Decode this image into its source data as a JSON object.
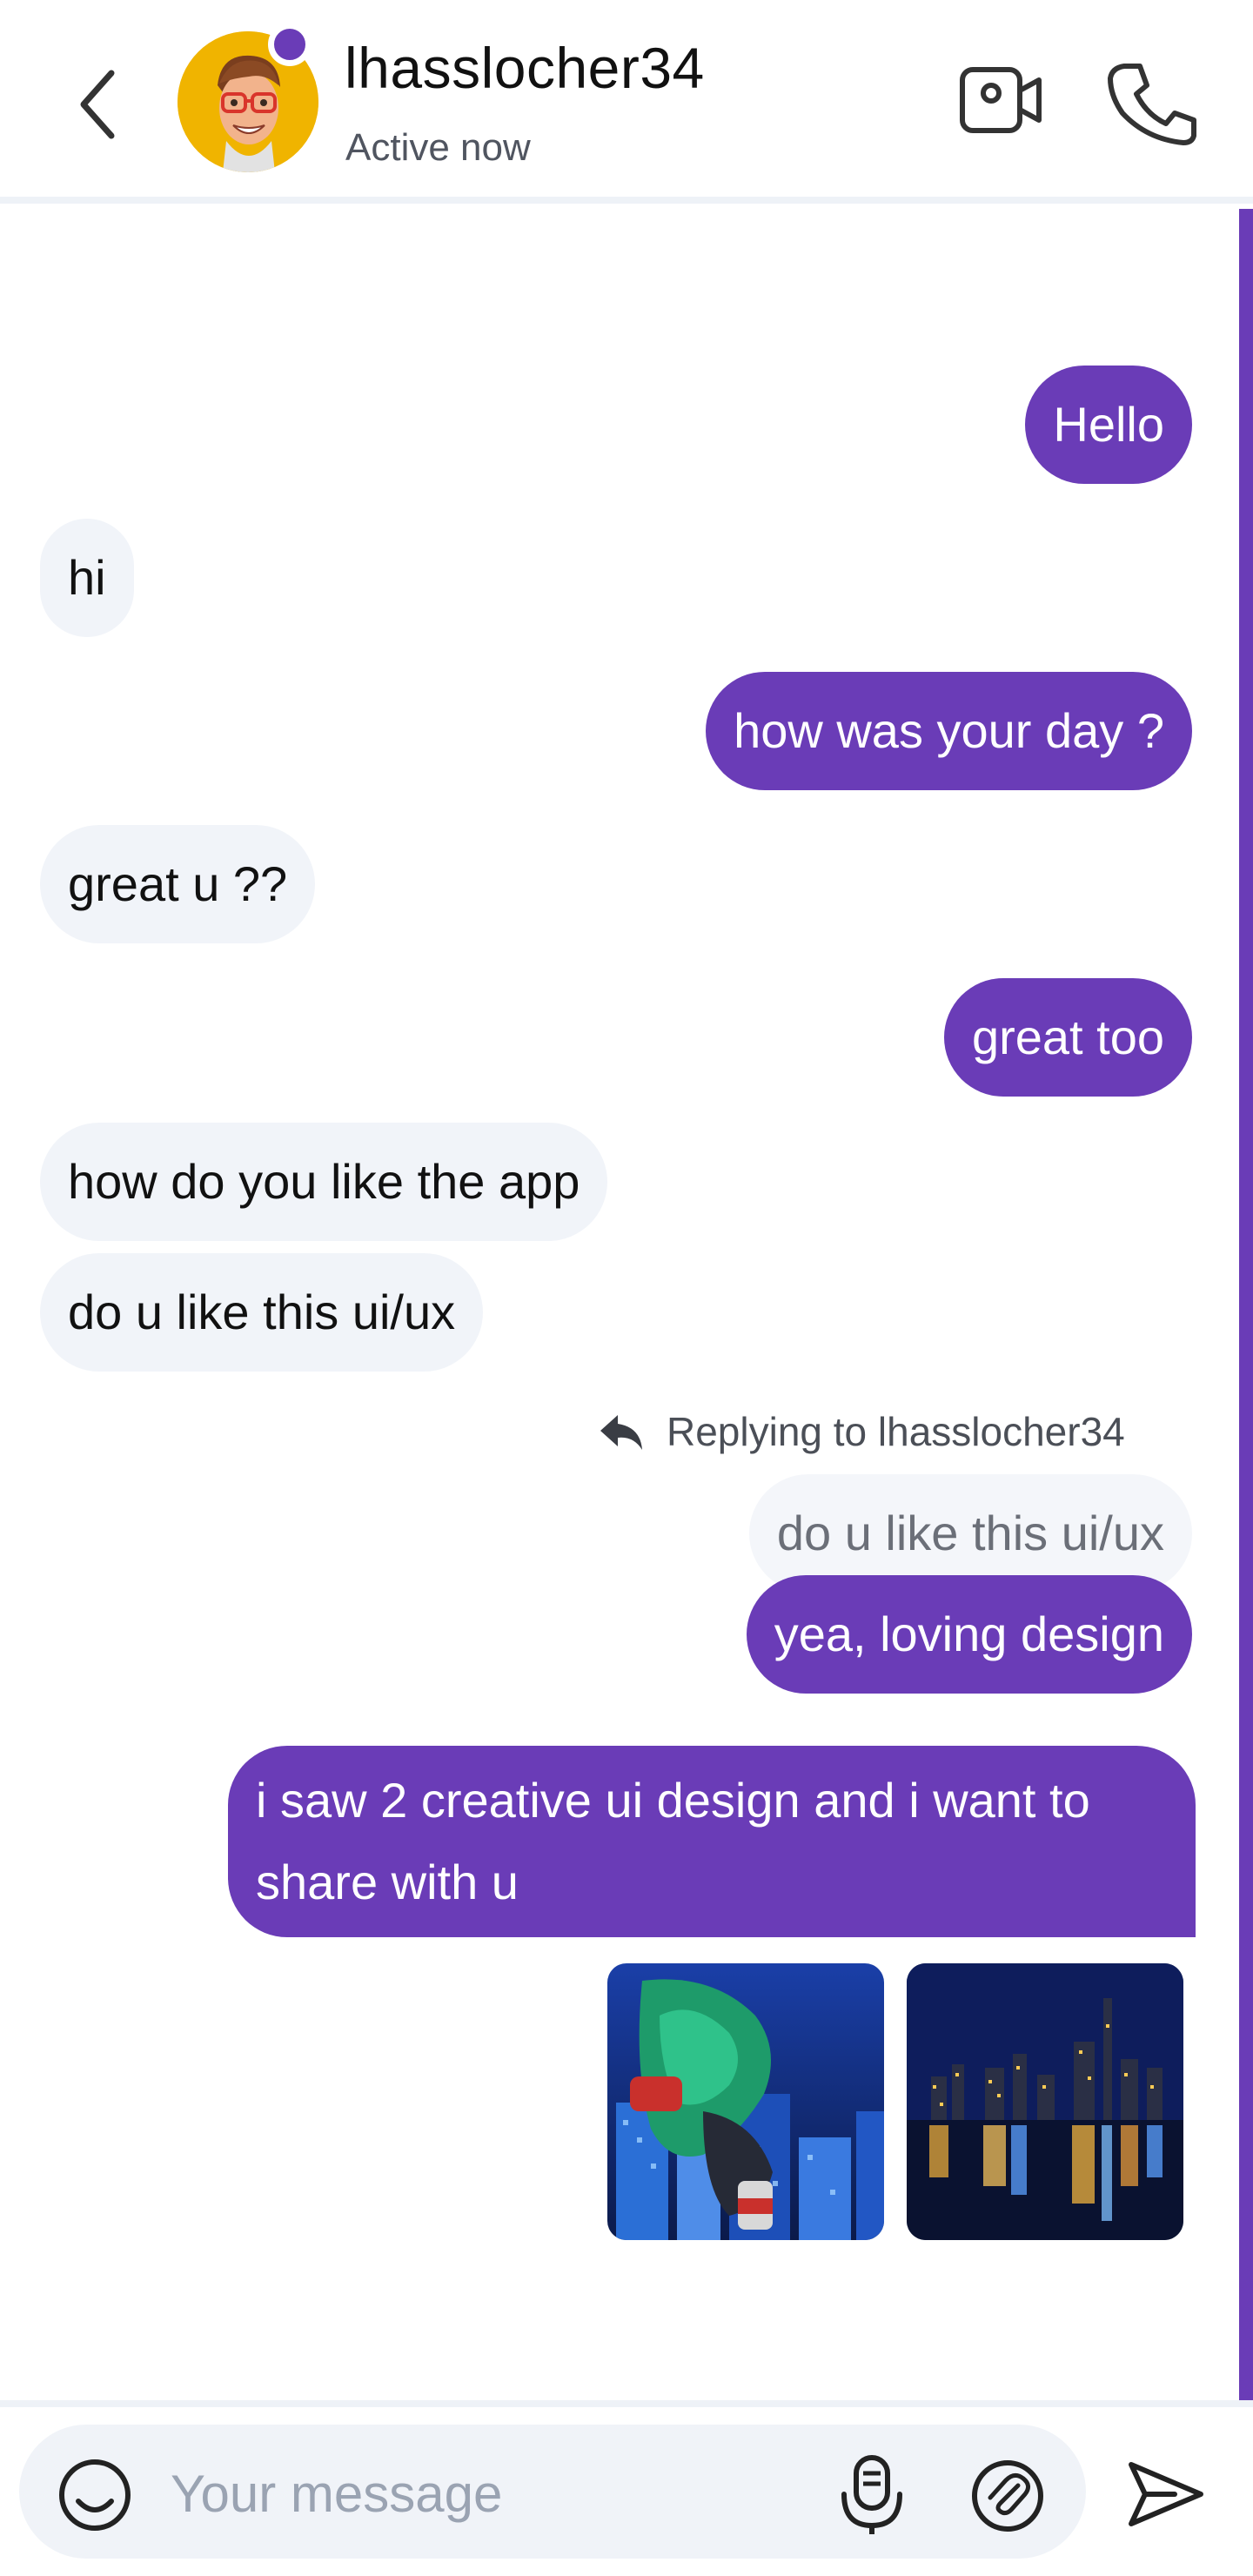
{
  "header": {
    "contact_name": "lhasslocher34",
    "status": "Active now",
    "icons": {
      "back": "chevron-left-icon",
      "video": "video-camera-icon",
      "call": "phone-icon"
    }
  },
  "messages": [
    {
      "side": "outgoing",
      "text": "Hello"
    },
    {
      "side": "incoming",
      "text": "hi"
    },
    {
      "side": "outgoing",
      "text": "how was your day ?"
    },
    {
      "side": "incoming",
      "text": "great u ??"
    },
    {
      "side": "outgoing",
      "text": "great too"
    },
    {
      "side": "incoming",
      "text": "how do you like the app"
    },
    {
      "side": "incoming",
      "text": "do u like this ui/ux"
    },
    {
      "side": "outgoing",
      "reply_label": "Replying to lhasslocher34",
      "quoted_text": "do u like this ui/ux",
      "text": "yea, loving design"
    },
    {
      "side": "outgoing",
      "text": "i saw 2 creative ui design and i want to share with u"
    }
  ],
  "images": [
    {
      "icon": "image-photo-icon"
    },
    {
      "icon": "image-photo-icon"
    }
  ],
  "composer": {
    "placeholder": "Your message",
    "icons": {
      "emoji": "emoji-icon",
      "mic": "microphone-icon",
      "attach": "attachment-icon",
      "send": "send-icon"
    }
  },
  "colors": {
    "accent": "#6a3cb7",
    "incoming_bubble": "#f1f4f9",
    "avatar_bg": "#f0b400"
  }
}
